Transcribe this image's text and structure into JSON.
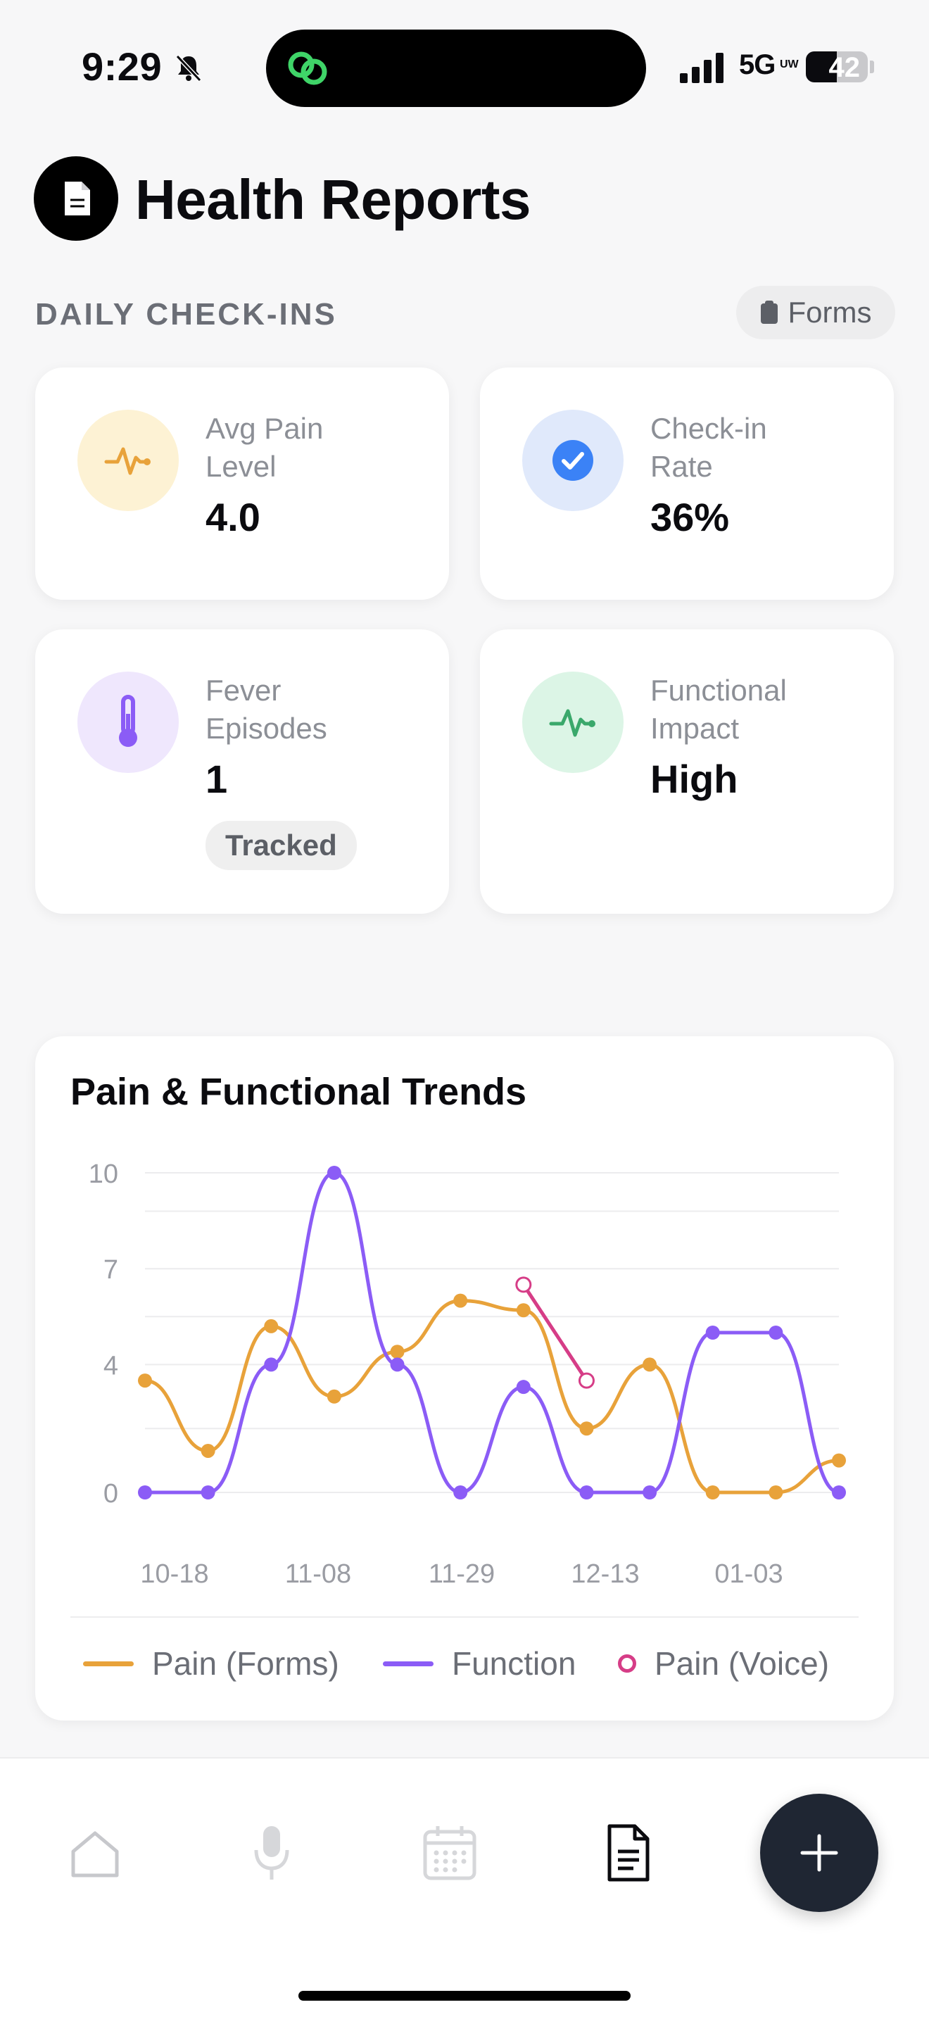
{
  "status_bar": {
    "time": "9:29",
    "network": "5G",
    "battery": "42",
    "icons": [
      "bell-slash-icon",
      "app-link-icon",
      "signal-icon",
      "battery-icon"
    ]
  },
  "header": {
    "title": "Health Reports",
    "icon": "document-icon"
  },
  "section": {
    "label": "DAILY CHECK-INS",
    "forms_button": "Forms",
    "forms_icon": "clipboard-icon"
  },
  "stats": [
    {
      "label": "Avg Pain Level",
      "value": "4.0",
      "icon": "pulse-icon",
      "color": "#e8a23a",
      "bg": "#fdf2d4"
    },
    {
      "label": "Check-in Rate",
      "value": "36%",
      "icon": "check-circle-icon",
      "color": "#3b82f6",
      "bg": "#e0e9fb"
    },
    {
      "label": "Fever Episodes",
      "value": "1",
      "badge": "Tracked",
      "icon": "thermometer-icon",
      "color": "#8b5cf6",
      "bg": "#efe7fd"
    },
    {
      "label": "Functional Impact",
      "value": "High",
      "icon": "pulse-icon",
      "color": "#3aa86b",
      "bg": "#dcf5e6"
    }
  ],
  "chart": {
    "title": "Pain & Functional Trends",
    "legend": [
      {
        "label": "Pain (Forms)",
        "color": "#e8a23a"
      },
      {
        "label": "Function",
        "color": "#8b5cf6"
      },
      {
        "label": "Pain (Voice)",
        "color": "#d63d87"
      }
    ]
  },
  "chart_data": {
    "type": "line",
    "ylim": [
      0,
      10
    ],
    "yticks": [
      "0",
      "4",
      "7",
      "10"
    ],
    "xticks": [
      "10-18",
      "11-08",
      "11-29",
      "12-13",
      "01-03"
    ],
    "series": [
      {
        "name": "Pain (Forms)",
        "color": "#e8a23a",
        "values": [
          3.5,
          1.3,
          5.2,
          3.0,
          4.4,
          6.0,
          5.7,
          2.0,
          4.0,
          0,
          0,
          1.0
        ]
      },
      {
        "name": "Function",
        "color": "#8b5cf6",
        "values": [
          0,
          0,
          4.0,
          10.0,
          4.0,
          0,
          3.3,
          0,
          0,
          5.0,
          5.0,
          0
        ]
      },
      {
        "name": "Pain (Voice)",
        "color": "#d63d87",
        "points": [
          {
            "i": 6,
            "v": 6.5
          },
          {
            "i": 7,
            "v": 3.5
          }
        ]
      }
    ]
  },
  "nav": {
    "items": [
      {
        "name": "home-icon",
        "active": false
      },
      {
        "name": "microphone-icon",
        "active": false
      },
      {
        "name": "calendar-icon",
        "active": false
      },
      {
        "name": "reports-icon",
        "active": true
      }
    ],
    "fab_icon": "plus-icon"
  }
}
